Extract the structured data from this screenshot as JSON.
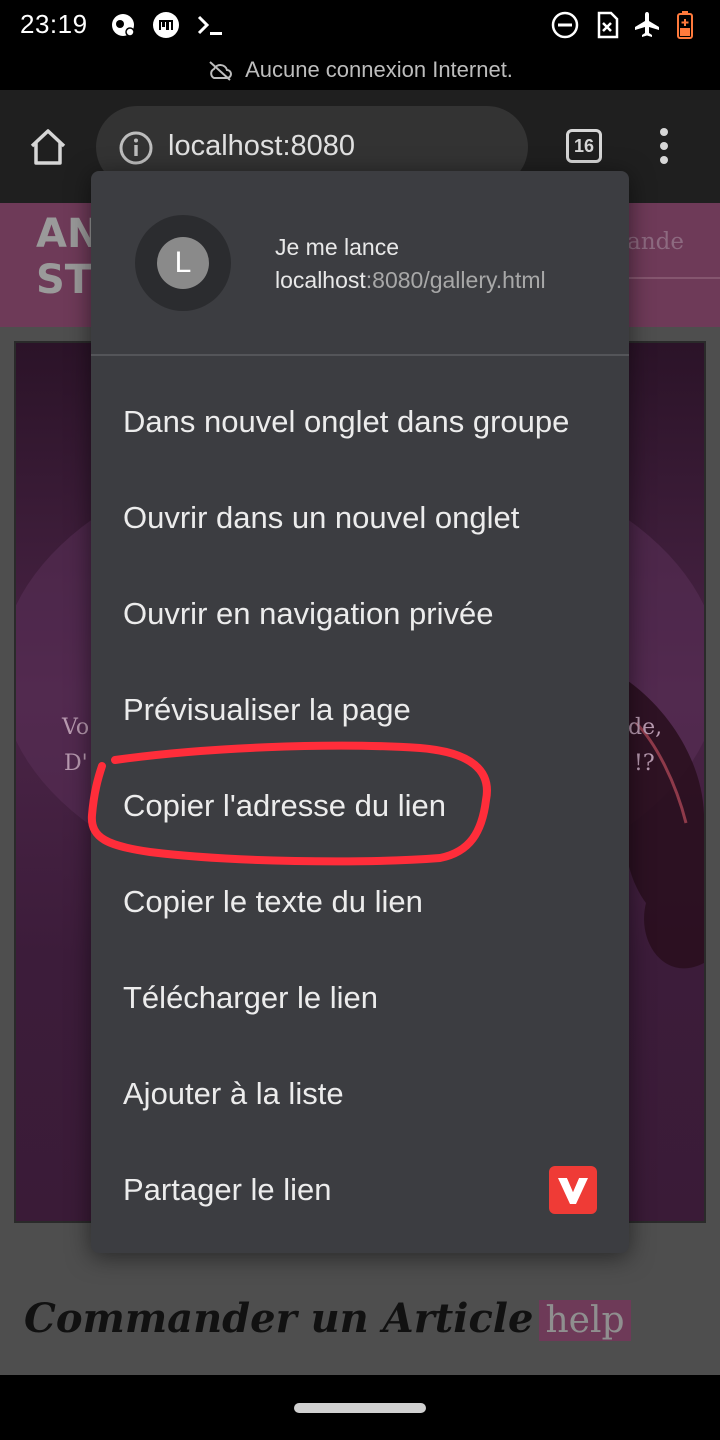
{
  "status_bar": {
    "time": "23:19"
  },
  "offline_banner": {
    "text": "Aucune connexion Internet."
  },
  "toolbar": {
    "url": "localhost:8080",
    "tab_count": "16"
  },
  "page": {
    "brand_line1": "AN",
    "brand_line2": "ST",
    "header_link": "ande",
    "hero_left_1": "Vo",
    "hero_left_2": "D'",
    "hero_right_1": "de,",
    "hero_right_2": "!?",
    "heading": "Commander un Article",
    "help_label": "help"
  },
  "context_menu": {
    "avatar_letter": "L",
    "link_title": "Je me lance",
    "link_url_host": "localhost",
    "link_url_rest": ":8080/gallery.html",
    "items": [
      {
        "label": "Dans nouvel onglet dans groupe"
      },
      {
        "label": "Ouvrir dans un nouvel onglet"
      },
      {
        "label": "Ouvrir en navigation privée"
      },
      {
        "label": "Prévisualiser la page"
      },
      {
        "label": "Copier l'adresse du lien"
      },
      {
        "label": "Copier le texte du lien"
      },
      {
        "label": "Télécharger le lien"
      },
      {
        "label": "Ajouter à la liste"
      },
      {
        "label": "Partager le lien"
      }
    ]
  },
  "colors": {
    "menu_bg": "#3c3d41",
    "annotation": "#ff2d3a",
    "share_app": "#ef3b36"
  }
}
